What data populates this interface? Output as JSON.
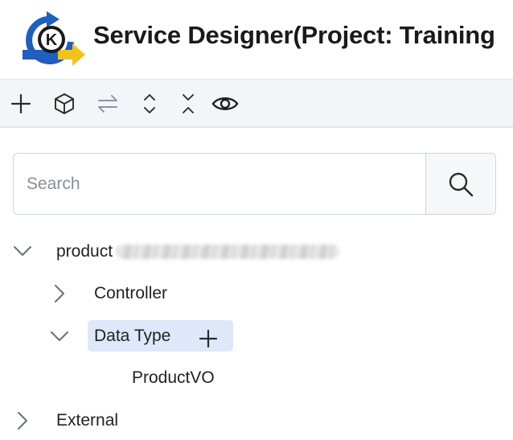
{
  "header": {
    "title": "Service Designer(Project: Training",
    "logo_letter": "K",
    "colors": {
      "logo_blue": "#1f5fbf",
      "logo_yellow": "#f2c21b",
      "logo_dark": "#1a1a1a"
    }
  },
  "toolbar": {
    "items": [
      {
        "icon": "plus-icon",
        "label": "Add"
      },
      {
        "icon": "cube-icon",
        "label": "Model"
      },
      {
        "icon": "swap-arrows-icon",
        "label": "Swap"
      },
      {
        "icon": "expand-all-icon",
        "label": "Expand all"
      },
      {
        "icon": "collapse-all-icon",
        "label": "Collapse all"
      },
      {
        "icon": "eye-icon",
        "label": "View"
      }
    ]
  },
  "search": {
    "placeholder": "Search",
    "value": "",
    "button_icon": "search-icon"
  },
  "tree": {
    "root": {
      "label": "product",
      "expanded": true,
      "chevron": "chevron-down-icon"
    },
    "children": [
      {
        "label": "Controller",
        "expanded": false,
        "chevron": "chevron-right-icon"
      },
      {
        "label": "Data Type",
        "expanded": true,
        "selected": true,
        "chevron": "chevron-down-icon",
        "action_icon": "plus-icon",
        "children": [
          {
            "label": "ProductVO"
          }
        ]
      }
    ],
    "siblings": [
      {
        "label": "External",
        "expanded": false,
        "chevron": "chevron-right-icon"
      }
    ]
  }
}
